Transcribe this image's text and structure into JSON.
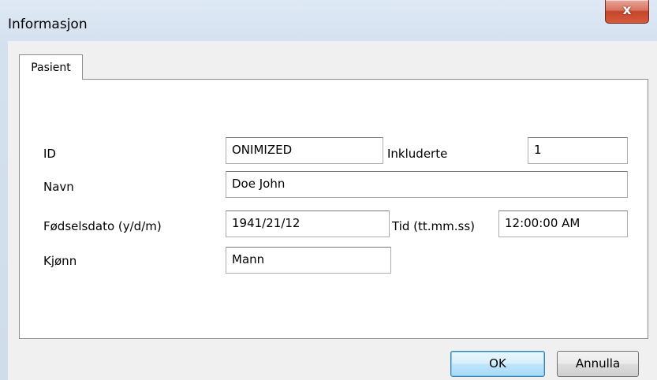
{
  "window": {
    "title": "Informasjon",
    "close_glyph": "x"
  },
  "tabs": [
    {
      "label": "Pasient",
      "selected": true
    }
  ],
  "form": {
    "id": {
      "label": "ID",
      "value": "ONIMIZED"
    },
    "inkluderte": {
      "label": "Inkluderte",
      "value": "1"
    },
    "navn": {
      "label": "Navn",
      "value": "Doe John"
    },
    "fodselsdato": {
      "label": "Fødselsdato (y/d/m)",
      "value": "1941/21/12"
    },
    "tid": {
      "label": "Tid (tt.mm.ss)",
      "value": "12:00:00 AM"
    },
    "kjonn": {
      "label": "Kjønn",
      "value": "Mann"
    }
  },
  "buttons": {
    "ok": "OK",
    "cancel": "Annulla"
  },
  "colors": {
    "close_button": "#c4462c",
    "default_button_border": "#3c7fb1",
    "client_background": "#f0f0f0"
  }
}
